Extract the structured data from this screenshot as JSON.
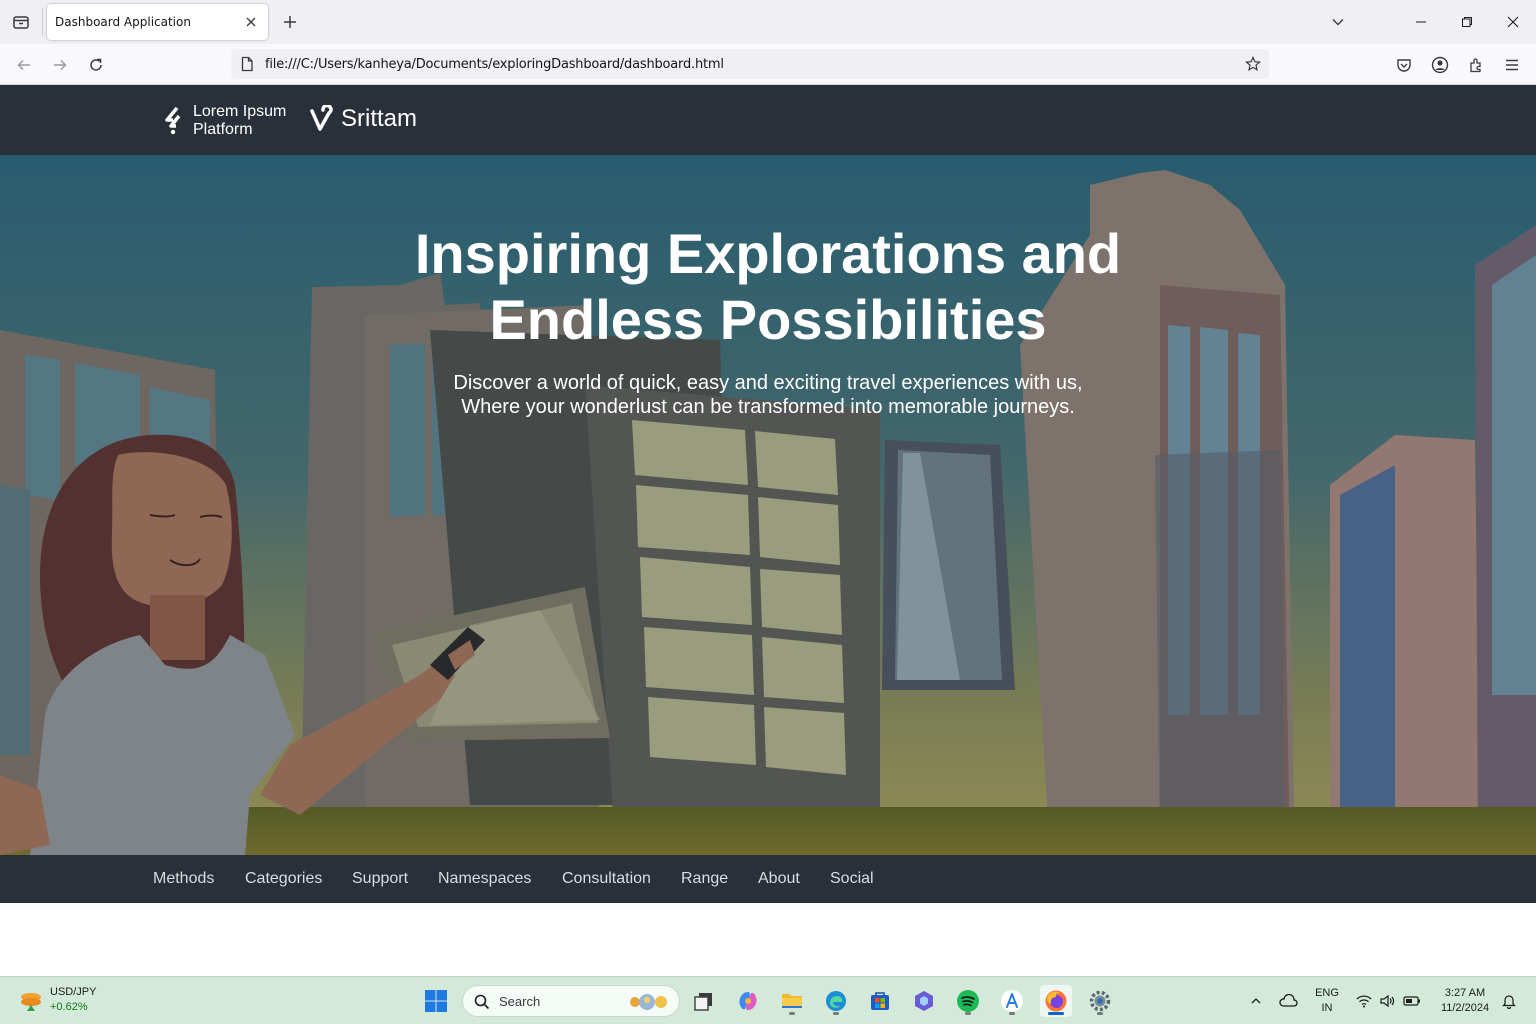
{
  "browser": {
    "tab_title": "Dashboard Application",
    "url": "file:///C:/Users/kanheya/Documents/exploringDashboard/dashboard.html"
  },
  "header": {
    "brand_line1": "Lorem Ipsum",
    "brand_line2": "Platform",
    "brand2": "Srittam"
  },
  "hero": {
    "title_line1": "Inspiring Explorations and",
    "title_line2": "Endless Possibilities",
    "subtitle_line1": "Discover a world of quick, easy and exciting travel experiences with us,",
    "subtitle_line2": "Where your wonderlust can be transformed into memorable journeys."
  },
  "menu": {
    "items": [
      "Methods",
      "Categories",
      "Support",
      "Namespaces",
      "Consultation",
      "Range",
      "About",
      "Social"
    ]
  },
  "taskbar": {
    "ticker_symbol": "USD/JPY",
    "ticker_change": "+0.62%",
    "search_placeholder": "Search",
    "lang_line1": "ENG",
    "lang_line2": "IN",
    "time": "3:27 AM",
    "date": "11/2/2024"
  },
  "colors": {
    "header_bg": "#2a3039",
    "taskbar_bg": "#d3eadb",
    "accent": "#0067c0"
  }
}
